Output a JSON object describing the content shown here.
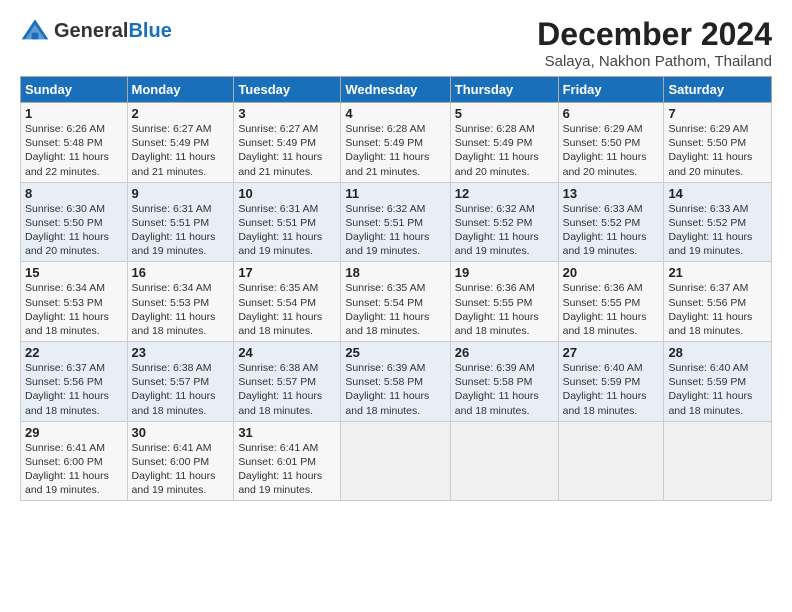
{
  "logo": {
    "general": "General",
    "blue": "Blue"
  },
  "title": "December 2024",
  "subtitle": "Salaya, Nakhon Pathom, Thailand",
  "days_of_week": [
    "Sunday",
    "Monday",
    "Tuesday",
    "Wednesday",
    "Thursday",
    "Friday",
    "Saturday"
  ],
  "weeks": [
    [
      {
        "day": 1,
        "info": "Sunrise: 6:26 AM\nSunset: 5:48 PM\nDaylight: 11 hours\nand 22 minutes."
      },
      {
        "day": 2,
        "info": "Sunrise: 6:27 AM\nSunset: 5:49 PM\nDaylight: 11 hours\nand 21 minutes."
      },
      {
        "day": 3,
        "info": "Sunrise: 6:27 AM\nSunset: 5:49 PM\nDaylight: 11 hours\nand 21 minutes."
      },
      {
        "day": 4,
        "info": "Sunrise: 6:28 AM\nSunset: 5:49 PM\nDaylight: 11 hours\nand 21 minutes."
      },
      {
        "day": 5,
        "info": "Sunrise: 6:28 AM\nSunset: 5:49 PM\nDaylight: 11 hours\nand 20 minutes."
      },
      {
        "day": 6,
        "info": "Sunrise: 6:29 AM\nSunset: 5:50 PM\nDaylight: 11 hours\nand 20 minutes."
      },
      {
        "day": 7,
        "info": "Sunrise: 6:29 AM\nSunset: 5:50 PM\nDaylight: 11 hours\nand 20 minutes."
      }
    ],
    [
      {
        "day": 8,
        "info": "Sunrise: 6:30 AM\nSunset: 5:50 PM\nDaylight: 11 hours\nand 20 minutes."
      },
      {
        "day": 9,
        "info": "Sunrise: 6:31 AM\nSunset: 5:51 PM\nDaylight: 11 hours\nand 19 minutes."
      },
      {
        "day": 10,
        "info": "Sunrise: 6:31 AM\nSunset: 5:51 PM\nDaylight: 11 hours\nand 19 minutes."
      },
      {
        "day": 11,
        "info": "Sunrise: 6:32 AM\nSunset: 5:51 PM\nDaylight: 11 hours\nand 19 minutes."
      },
      {
        "day": 12,
        "info": "Sunrise: 6:32 AM\nSunset: 5:52 PM\nDaylight: 11 hours\nand 19 minutes."
      },
      {
        "day": 13,
        "info": "Sunrise: 6:33 AM\nSunset: 5:52 PM\nDaylight: 11 hours\nand 19 minutes."
      },
      {
        "day": 14,
        "info": "Sunrise: 6:33 AM\nSunset: 5:52 PM\nDaylight: 11 hours\nand 19 minutes."
      }
    ],
    [
      {
        "day": 15,
        "info": "Sunrise: 6:34 AM\nSunset: 5:53 PM\nDaylight: 11 hours\nand 18 minutes."
      },
      {
        "day": 16,
        "info": "Sunrise: 6:34 AM\nSunset: 5:53 PM\nDaylight: 11 hours\nand 18 minutes."
      },
      {
        "day": 17,
        "info": "Sunrise: 6:35 AM\nSunset: 5:54 PM\nDaylight: 11 hours\nand 18 minutes."
      },
      {
        "day": 18,
        "info": "Sunrise: 6:35 AM\nSunset: 5:54 PM\nDaylight: 11 hours\nand 18 minutes."
      },
      {
        "day": 19,
        "info": "Sunrise: 6:36 AM\nSunset: 5:55 PM\nDaylight: 11 hours\nand 18 minutes."
      },
      {
        "day": 20,
        "info": "Sunrise: 6:36 AM\nSunset: 5:55 PM\nDaylight: 11 hours\nand 18 minutes."
      },
      {
        "day": 21,
        "info": "Sunrise: 6:37 AM\nSunset: 5:56 PM\nDaylight: 11 hours\nand 18 minutes."
      }
    ],
    [
      {
        "day": 22,
        "info": "Sunrise: 6:37 AM\nSunset: 5:56 PM\nDaylight: 11 hours\nand 18 minutes."
      },
      {
        "day": 23,
        "info": "Sunrise: 6:38 AM\nSunset: 5:57 PM\nDaylight: 11 hours\nand 18 minutes."
      },
      {
        "day": 24,
        "info": "Sunrise: 6:38 AM\nSunset: 5:57 PM\nDaylight: 11 hours\nand 18 minutes."
      },
      {
        "day": 25,
        "info": "Sunrise: 6:39 AM\nSunset: 5:58 PM\nDaylight: 11 hours\nand 18 minutes."
      },
      {
        "day": 26,
        "info": "Sunrise: 6:39 AM\nSunset: 5:58 PM\nDaylight: 11 hours\nand 18 minutes."
      },
      {
        "day": 27,
        "info": "Sunrise: 6:40 AM\nSunset: 5:59 PM\nDaylight: 11 hours\nand 18 minutes."
      },
      {
        "day": 28,
        "info": "Sunrise: 6:40 AM\nSunset: 5:59 PM\nDaylight: 11 hours\nand 18 minutes."
      }
    ],
    [
      {
        "day": 29,
        "info": "Sunrise: 6:41 AM\nSunset: 6:00 PM\nDaylight: 11 hours\nand 19 minutes."
      },
      {
        "day": 30,
        "info": "Sunrise: 6:41 AM\nSunset: 6:00 PM\nDaylight: 11 hours\nand 19 minutes."
      },
      {
        "day": 31,
        "info": "Sunrise: 6:41 AM\nSunset: 6:01 PM\nDaylight: 11 hours\nand 19 minutes."
      },
      {
        "day": null,
        "info": ""
      },
      {
        "day": null,
        "info": ""
      },
      {
        "day": null,
        "info": ""
      },
      {
        "day": null,
        "info": ""
      }
    ]
  ]
}
